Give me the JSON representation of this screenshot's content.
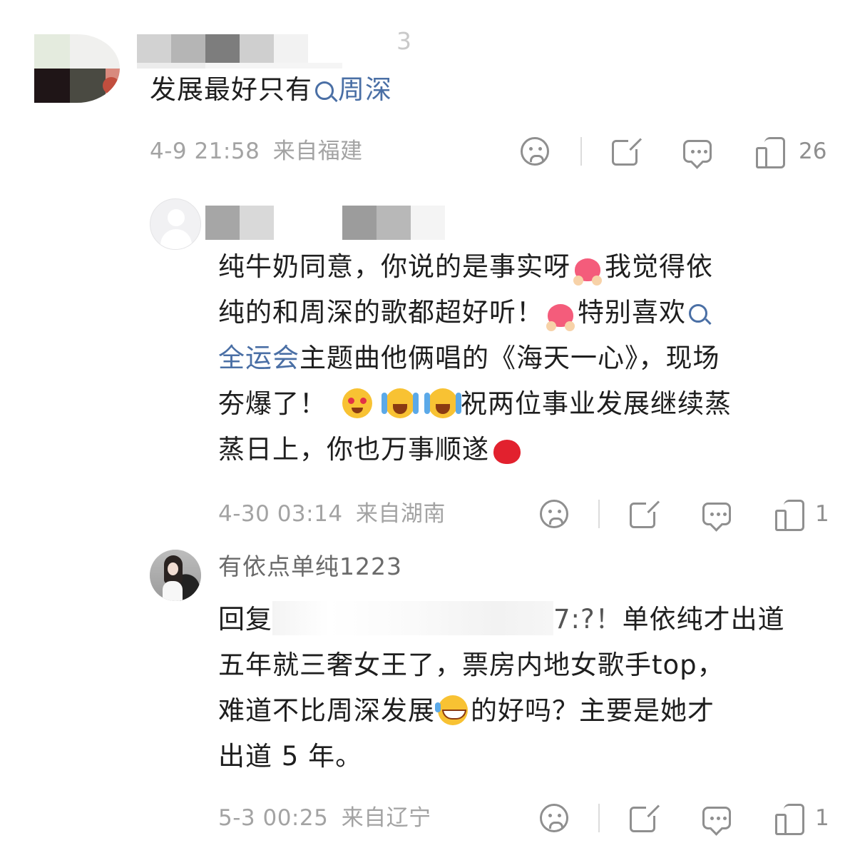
{
  "comment": {
    "text_prefix": "发展最好只有",
    "topic_link": "周深",
    "date": "4-9 21:58",
    "location": "来自福建",
    "like_count": "26",
    "partial_char": "3"
  },
  "reply1": {
    "line1_a": "纯牛奶同意，你说的是事实呀",
    "line1_b": "我觉得依",
    "line2_a": "纯的和周深的歌都超好听！",
    "line2_b": "特别喜欢",
    "line3_link": "全运会",
    "line3_b": "主题曲他俩唱的《海天一心》，现场",
    "line4_a": "夯爆了！",
    "line4_b": "祝两位事业发展继续蒸",
    "line5_a": "蒸日上，你也万事顺遂",
    "date": "4-30 03:14",
    "location": "来自湖南",
    "like_count": "1"
  },
  "reply2": {
    "username": "有依点单纯1223",
    "line1_prefix": "回复",
    "line1_partial": "7:?！",
    "line1_b": "单依纯才出道",
    "line2": "五年就三奢女王了，票房内地女歌手top，",
    "line3_a": "难道不比周深发展",
    "line3_b": "的好吗？主要是她才",
    "line4": "出道 5 年。",
    "date": "5-3 00:25",
    "location": "来自辽宁",
    "like_count": "1"
  },
  "icons": {
    "dislike": "sad-face-icon",
    "share": "share-icon",
    "comment": "comment-icon",
    "like": "thumbs-up-icon",
    "search": "search-icon",
    "emojis": [
      "heart-hands-emoji",
      "heart-eyes-emoji",
      "crying-laugh-emoji",
      "laughing-tears-emoji",
      "red-heart-emoji"
    ]
  }
}
